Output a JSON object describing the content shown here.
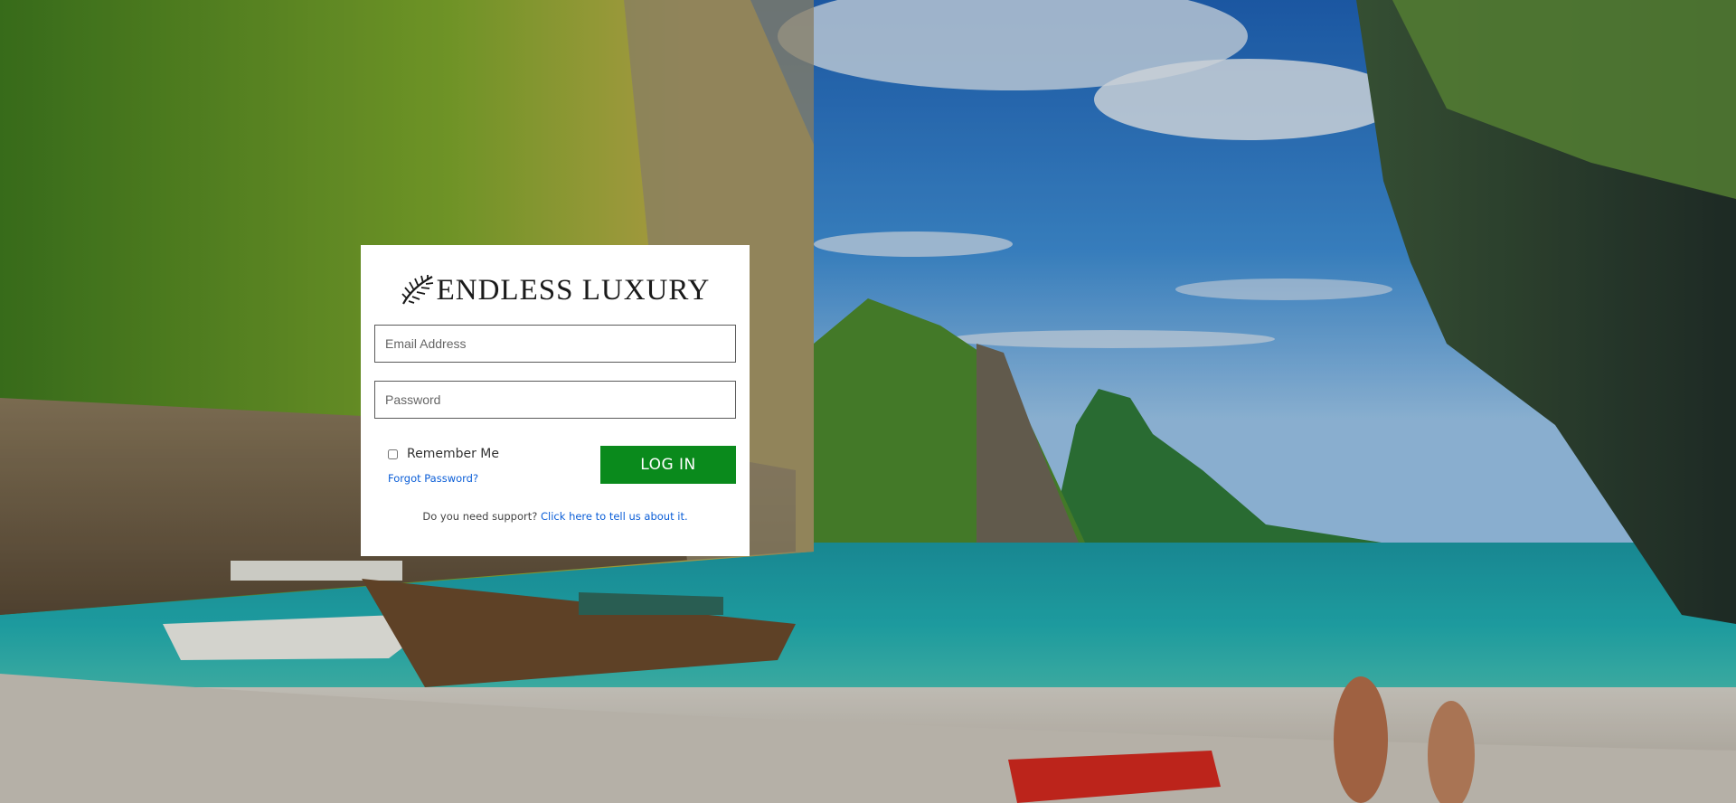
{
  "brand": {
    "name": "ENDLESS LUXURY",
    "logo_icon": "palm-leaf-icon"
  },
  "login_form": {
    "email_placeholder": "Email Address",
    "email_value": "",
    "password_placeholder": "Password",
    "password_value": "",
    "remember_label": "Remember Me",
    "remember_checked": false,
    "login_label": "LOG IN",
    "forgot_label": "Forgot Password?",
    "support_text": "Do you need support?",
    "support_link": "Click here to tell us about it."
  },
  "colors": {
    "login_button": "#0a8a1c",
    "link": "#0b5ed7"
  }
}
